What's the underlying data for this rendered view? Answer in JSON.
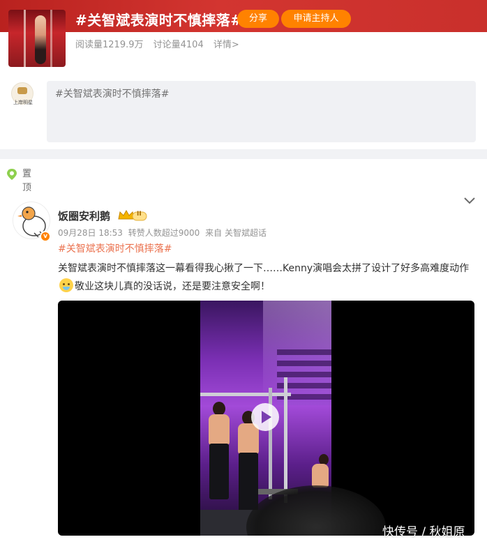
{
  "topic": {
    "title": "#关智斌表演时不慎摔落#",
    "share_label": "分享",
    "host_label": "申请主持人",
    "read_count": "阅读量1219.9万",
    "discuss_count": "讨论量4104",
    "detail_link": "详情>"
  },
  "composer": {
    "placeholder": "#关智斌表演时不慎摔落#",
    "avatar_caption": "上岸明星"
  },
  "post": {
    "pinned_label": "置顶",
    "author_name": "饭圈安利鹅",
    "rank_badge": "II",
    "verified_mark": "v",
    "date": "09月28日 18:53",
    "reposts": "转赞人数超过9000",
    "source": "来自 关智斌超话",
    "hashtag": "#关智斌表演时不慎摔落#",
    "text_part1": "关智斌表演时不慎摔落这一幕看得我心揪了一下……Kenny演唱会太拼了设计了好多高难度动作",
    "text_part2": "敬业这块儿真的没话说，还是要注意安全啊！"
  },
  "watermark": "快传号 / 秋姐原",
  "colors": {
    "brand_red": "#c9302c",
    "accent_orange": "#ff8200",
    "hashtag_color": "#eb7350"
  }
}
